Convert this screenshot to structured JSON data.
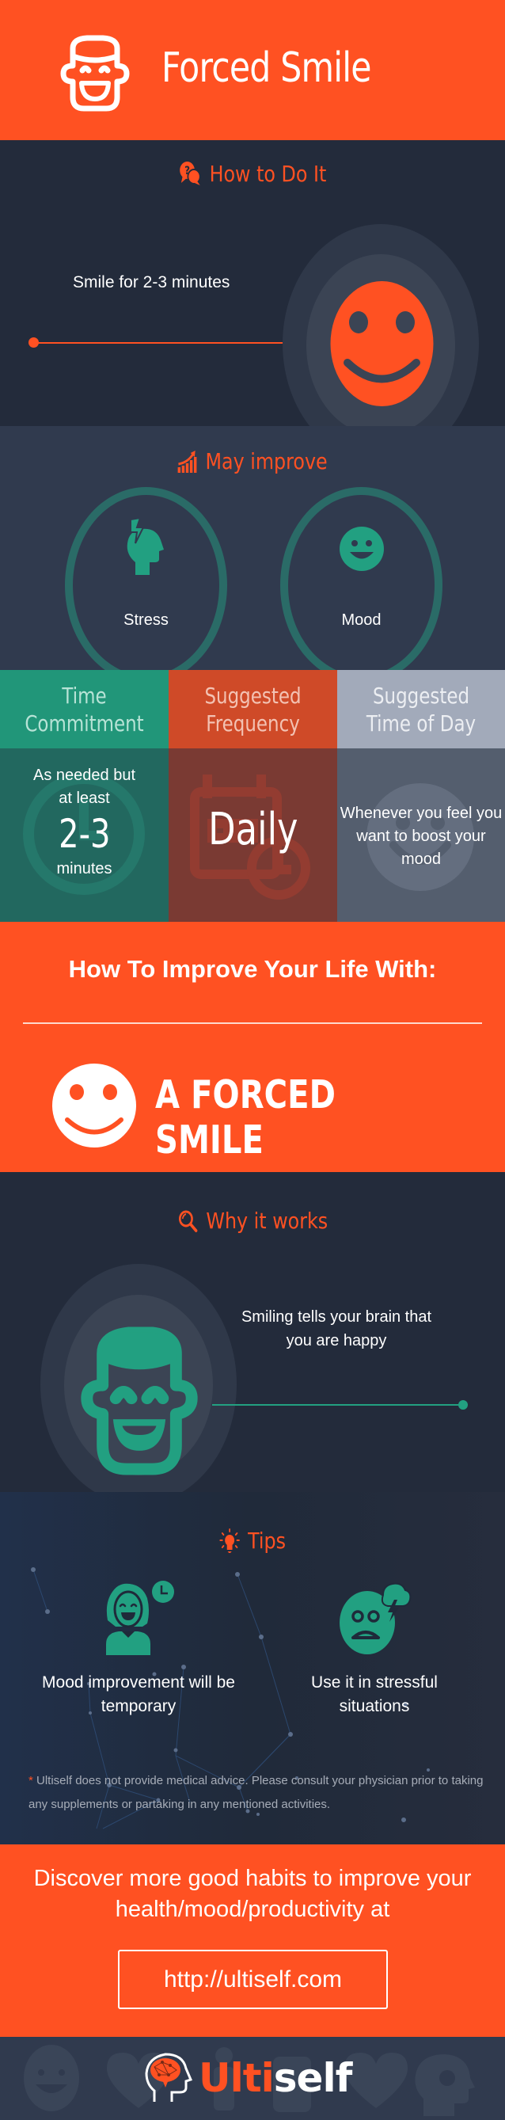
{
  "colors": {
    "brand_orange": "#ff5122",
    "dark_navy": "#232b3b",
    "slate": "#303a4e",
    "teal": "#219679",
    "teal_dark": "#22685f",
    "rust": "#cf4a28",
    "rust_dark": "#7a3a33",
    "gray_blue": "#a2aaba",
    "gray_dark": "#545e6e"
  },
  "header": {
    "icon": "grinning-man-face-icon",
    "title": "Forced Smile"
  },
  "how_to": {
    "icon": "question-chat-bubbles-icon",
    "title": "How to Do It",
    "step_text": "Smile for 2-3 minutes",
    "illustration": "smiley-face-icon"
  },
  "may_improve": {
    "icon": "rising-bar-chart-icon",
    "title": "May improve",
    "items": [
      {
        "label": "Stress",
        "icon": "stressed-head-lightning-icon"
      },
      {
        "label": "Mood",
        "icon": "happy-face-icon"
      }
    ]
  },
  "stats": [
    {
      "heading": "Time Commitment",
      "line1": "As needed but",
      "line2": "at least",
      "value": "2-3",
      "unit": "minutes",
      "bg_icon": "clock-icon"
    },
    {
      "heading": "Suggested Frequency",
      "value": "Daily",
      "bg_icon": "calendar-clock-icon"
    },
    {
      "heading": "Suggested Time of Day",
      "value": "Whenever you feel you want to boost your mood",
      "bg_icon": "smiley-face-icon"
    }
  ],
  "improve_life": {
    "heading": "How To Improve Your Life With:",
    "habit": "A FORCED SMILE",
    "icon": "smiley-face-icon"
  },
  "why_it_works": {
    "icon": "magnifier-icon",
    "title": "Why it works",
    "text": "Smiling tells your brain that you are happy",
    "illustration": "grinning-man-face-icon"
  },
  "tips": {
    "icon": "lightbulb-icon",
    "title": "Tips",
    "items": [
      {
        "label": "Mood improvement will be temporary",
        "icon": "smiling-woman-clock-icon"
      },
      {
        "label": "Use it in stressful situations",
        "icon": "anxious-face-storm-icon"
      }
    ],
    "disclaimer_mark": "*",
    "disclaimer": "Ultiself does not provide medical advice. Please consult your physician prior to taking any supplements or partaking in any mentioned activities."
  },
  "cta": {
    "text": "Discover more good habits to improve your health/mood/productivity at",
    "url_label": "http://ultiself.com"
  },
  "footer": {
    "logo_part1": "Ulti",
    "logo_part2": "self",
    "logo_icon": "brain-head-icon"
  }
}
